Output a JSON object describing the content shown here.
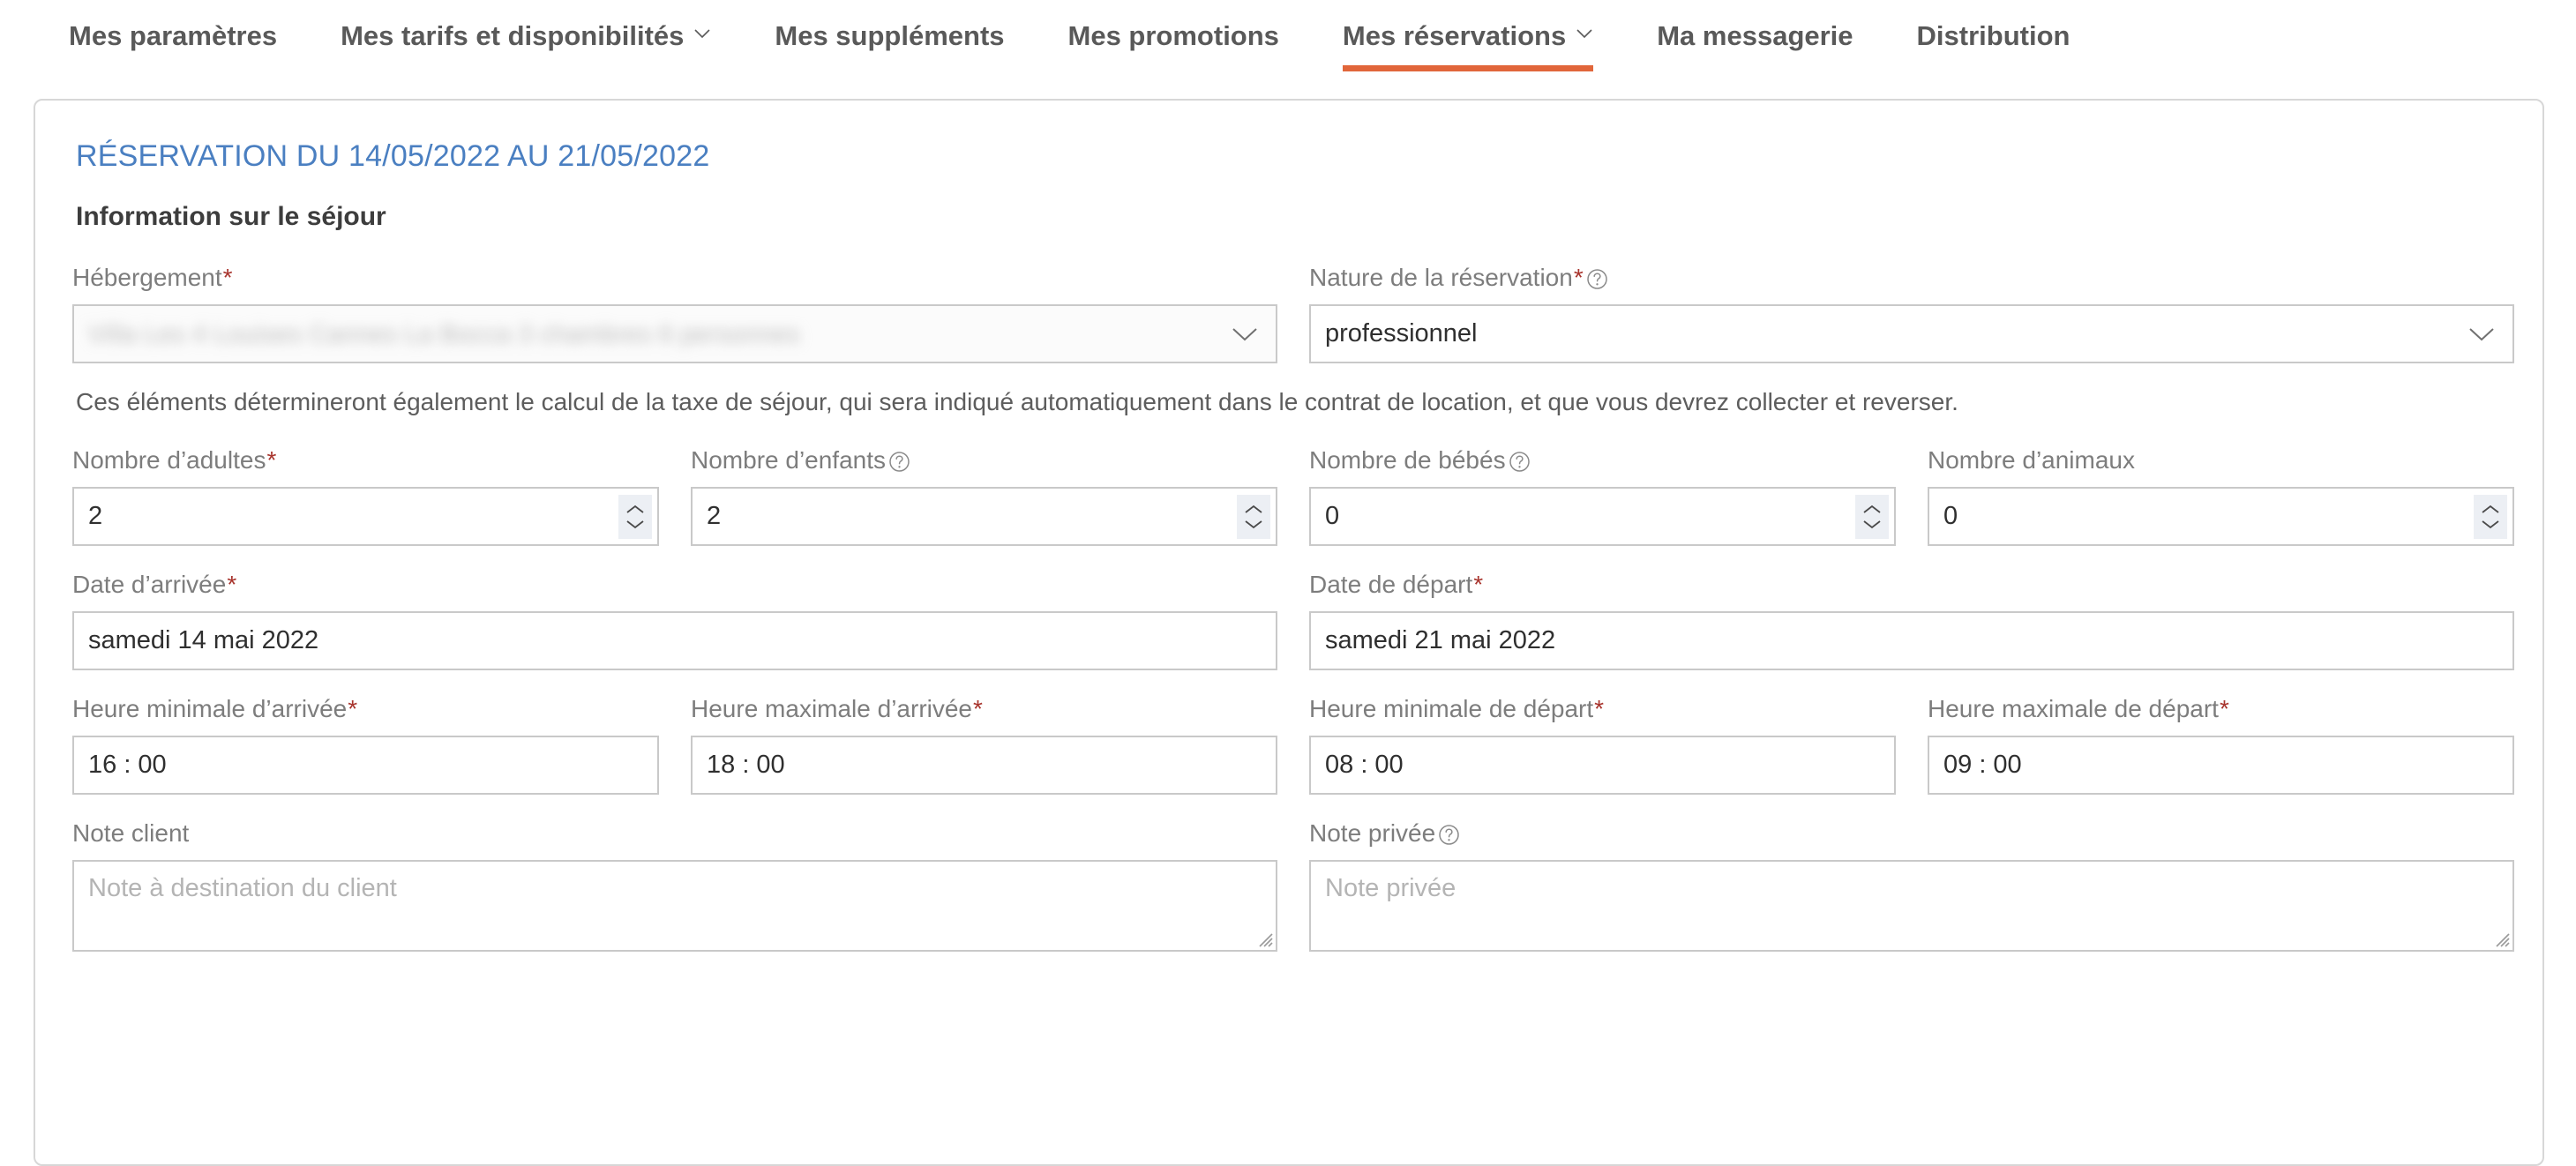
{
  "nav": {
    "items": [
      {
        "label": "Mes paramètres",
        "caret": false,
        "active": false,
        "icon": null
      },
      {
        "label": "Mes tarifs et disponibilités",
        "caret": true,
        "active": false,
        "icon": "chevron-down-icon"
      },
      {
        "label": "Mes suppléments",
        "caret": false,
        "active": false,
        "icon": null
      },
      {
        "label": "Mes promotions",
        "caret": false,
        "active": false,
        "icon": null
      },
      {
        "label": "Mes réservations",
        "caret": true,
        "active": true,
        "icon": "chevron-down-icon"
      },
      {
        "label": "Ma messagerie",
        "caret": false,
        "active": false,
        "icon": null
      },
      {
        "label": "Distribution",
        "caret": false,
        "active": false,
        "icon": null
      }
    ],
    "active_underline_color": "#e1663a"
  },
  "card": {
    "title": "RÉSERVATION DU 14/05/2022 AU 21/05/2022",
    "title_color": "#4a7fc1",
    "section_title": "Information sur le séjour",
    "info_text": "Ces éléments détermineront également le calcul de la taxe de séjour, qui sera indiqué automatiquement dans le contrat de location, et que vous devrez collecter et reverser."
  },
  "fields": {
    "hebergement": {
      "label": "Hébergement",
      "required": "*",
      "value": "Villa Les 4 Louises Cannes La Bocca 3 chambres 6 personnes",
      "redacted": true,
      "icon": "chevron-down-icon"
    },
    "nature": {
      "label": "Nature de la réservation",
      "required": "*",
      "help": "help-icon",
      "value": "professionnel",
      "icon": "chevron-down-icon"
    },
    "adultes": {
      "label": "Nombre d’adultes",
      "required": "*",
      "value": "2",
      "icon": "spinner-icon"
    },
    "enfants": {
      "label": "Nombre d’enfants",
      "required": "",
      "help": "help-icon",
      "value": "2",
      "icon": "spinner-icon"
    },
    "bebes": {
      "label": "Nombre de bébés",
      "required": "",
      "help": "help-icon",
      "value": "0",
      "icon": "spinner-icon"
    },
    "animaux": {
      "label": "Nombre d’animaux",
      "required": "",
      "value": "0",
      "icon": "spinner-icon"
    },
    "date_arrivee": {
      "label": "Date d’arrivée",
      "required": "*",
      "value": "samedi 14 mai 2022"
    },
    "date_depart": {
      "label": "Date de départ",
      "required": "*",
      "value": "samedi 21 mai 2022"
    },
    "heure_min_arrivee": {
      "label": "Heure minimale d’arrivée",
      "required": "*",
      "value": "16 : 00"
    },
    "heure_max_arrivee": {
      "label": "Heure maximale d’arrivée",
      "required": "*",
      "value": "18 : 00"
    },
    "heure_min_depart": {
      "label": "Heure minimale de départ",
      "required": "*",
      "value": "08 : 00"
    },
    "heure_max_depart": {
      "label": "Heure maximale de départ",
      "required": "*",
      "value": "09 : 00"
    },
    "note_client": {
      "label": "Note client",
      "required": "",
      "value": "",
      "placeholder": "Note à destination du client",
      "icon": "resize-grip-icon"
    },
    "note_privee": {
      "label": "Note privée",
      "required": "",
      "help": "help-icon",
      "value": "",
      "placeholder": "Note privée",
      "icon": "resize-grip-icon"
    }
  },
  "colors": {
    "accent": "#e1663a",
    "title_blue": "#4a7fc1",
    "required_red": "#a8342d",
    "label_grey": "#7d7d7d",
    "border_grey": "#c9c9c9"
  }
}
